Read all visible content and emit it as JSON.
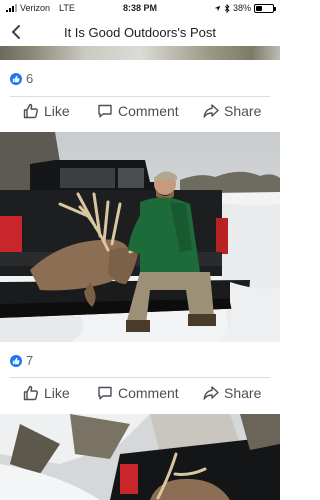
{
  "status": {
    "carrier": "Verizon",
    "network": "LTE",
    "time": "8:38 PM",
    "battery_text": "38%",
    "battery_level": 0.38
  },
  "header": {
    "title": "It Is Good Outdoors's Post"
  },
  "posts": [
    {
      "reaction_count": "6",
      "actions": {
        "like": "Like",
        "comment": "Comment",
        "share": "Share"
      }
    },
    {
      "reaction_count": "7",
      "actions": {
        "like": "Like",
        "comment": "Comment",
        "share": "Share"
      }
    }
  ],
  "colors": {
    "accent": "#1877f2",
    "text": "#1c1e21",
    "muted": "#606770",
    "action_text": "#4b4f56",
    "divider": "#dadde1"
  },
  "icons": [
    "back-chevron-icon",
    "like-thumb-icon",
    "comment-bubble-icon",
    "share-arrow-icon",
    "location-arrow-icon",
    "bluetooth-icon"
  ]
}
